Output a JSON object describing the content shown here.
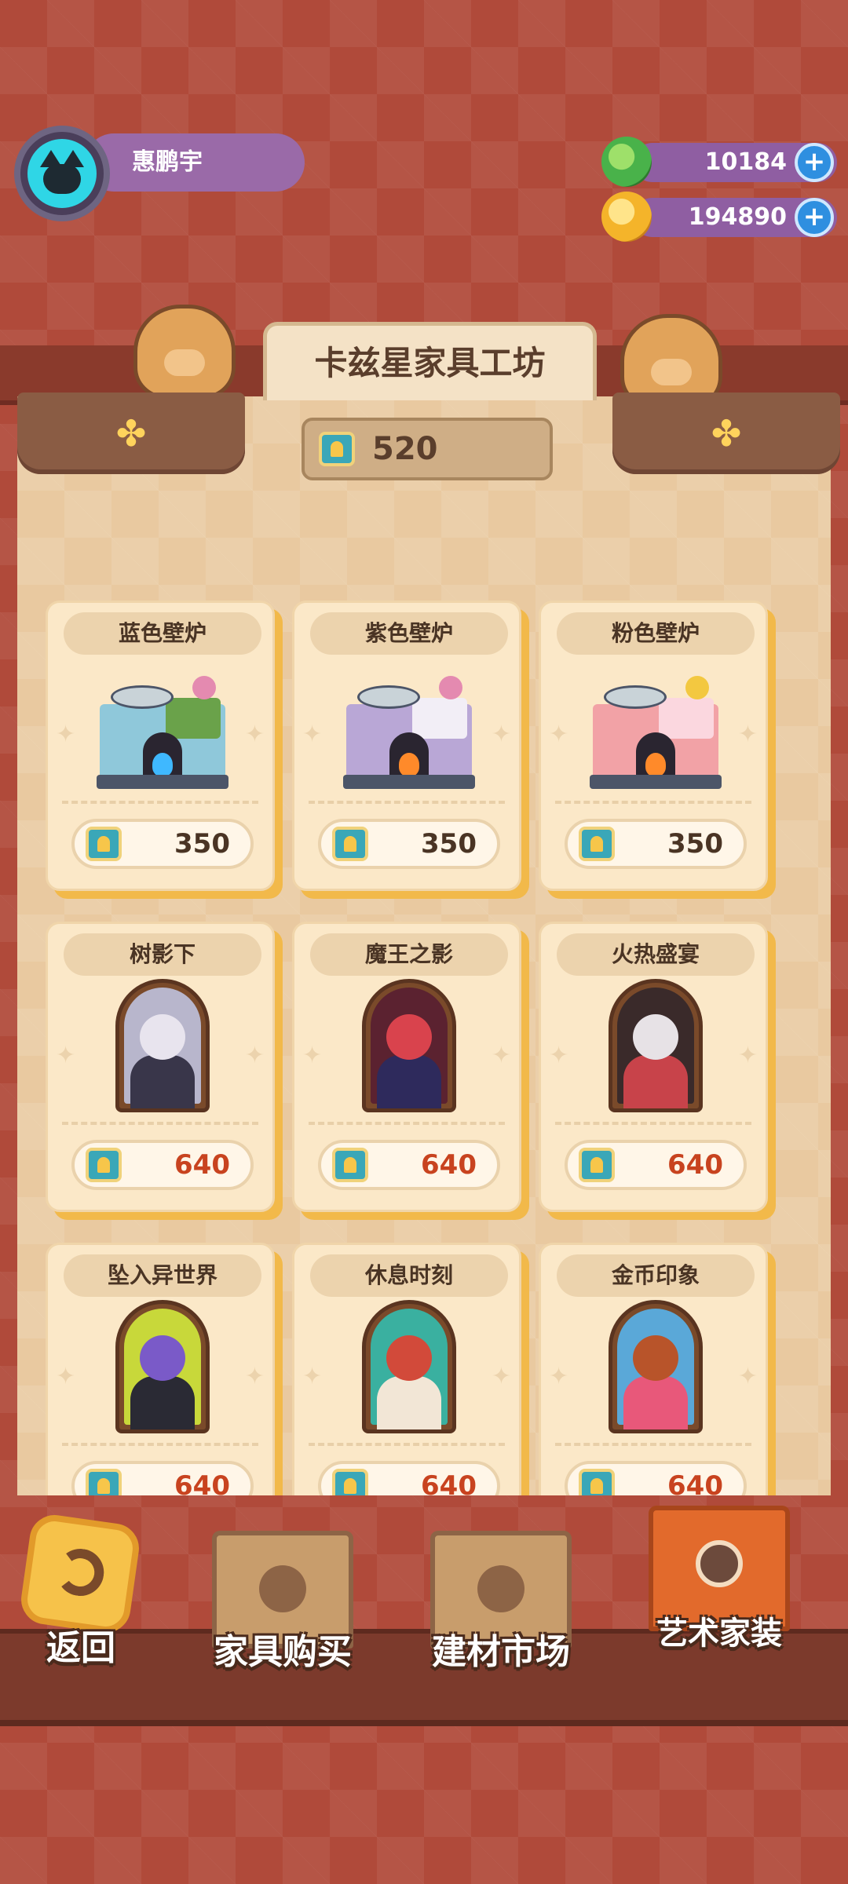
{
  "player": {
    "name": "惠鹏宇"
  },
  "currencies": [
    {
      "id": "green",
      "amount": "10184",
      "color": "#49b24a"
    },
    {
      "id": "gold",
      "amount": "194890",
      "color": "#f4b42a"
    }
  ],
  "shop": {
    "title": "卡兹星家具工坊",
    "balance": "520"
  },
  "items": [
    {
      "name": "蓝色壁炉",
      "price": "350",
      "kind": "fireplace",
      "theme": "#8fc8da",
      "cloth": "#6aa24a",
      "fire": "#3fb8ff",
      "pot": "#e48ab0"
    },
    {
      "name": "紫色壁炉",
      "price": "350",
      "kind": "fireplace",
      "theme": "#b9a7d6",
      "cloth": "#f2eef6",
      "fire": "#ff8a2a",
      "pot": "#e48ab0"
    },
    {
      "name": "粉色壁炉",
      "price": "350",
      "kind": "fireplace",
      "theme": "#f2a2a6",
      "cloth": "#fbd7df",
      "fire": "#ff8a2a",
      "pot": "#f3c840"
    },
    {
      "name": "树影下",
      "price": "640",
      "kind": "painting",
      "bg": "#b8b6cc",
      "head": "#e8e4ee",
      "body": "#39364a"
    },
    {
      "name": "魔王之影",
      "price": "640",
      "kind": "painting",
      "bg": "#5b2230",
      "head": "#d9434d",
      "body": "#2e2a5c"
    },
    {
      "name": "火热盛宴",
      "price": "640",
      "kind": "painting",
      "bg": "#3a2a2a",
      "head": "#e7e2e6",
      "body": "#c8434a"
    },
    {
      "name": "坠入异世界",
      "price": "640",
      "kind": "painting",
      "bg": "#c8d83a",
      "head": "#7a5ac8",
      "body": "#2a2a34"
    },
    {
      "name": "休息时刻",
      "price": "640",
      "kind": "painting",
      "bg": "#3ab0a0",
      "head": "#d24a3a",
      "body": "#f2e6d6"
    },
    {
      "name": "金币印象",
      "price": "640",
      "kind": "painting",
      "bg": "#5aa8d8",
      "head": "#b8542a",
      "body": "#e8587a"
    }
  ],
  "nav": [
    {
      "id": "back",
      "label": "返回"
    },
    {
      "id": "furniture",
      "label": "家具购买"
    },
    {
      "id": "materials",
      "label": "建材市场"
    },
    {
      "id": "art",
      "label": "艺术家装"
    }
  ]
}
